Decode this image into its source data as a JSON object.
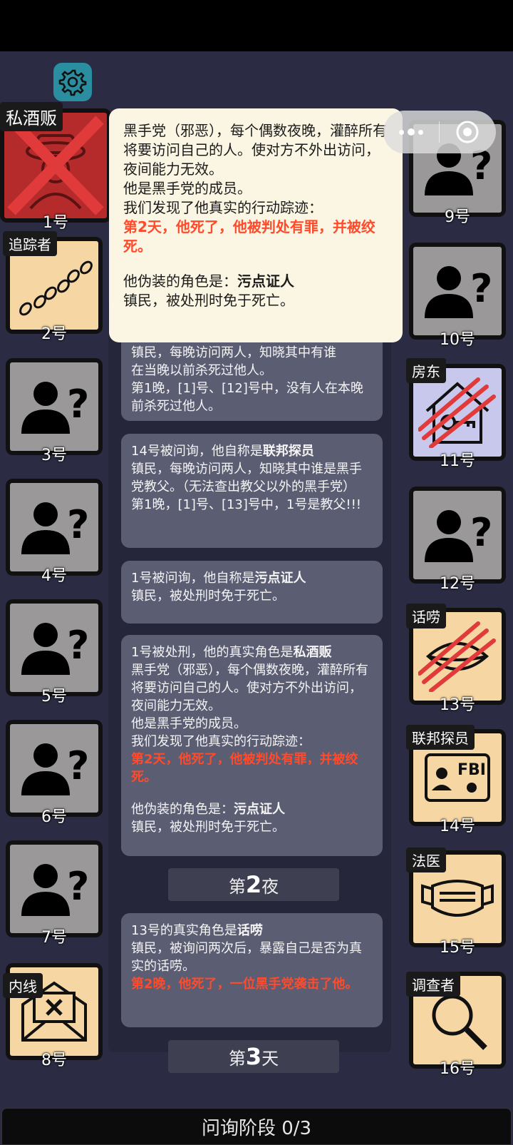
{
  "header": {
    "settings_icon": "gear-icon",
    "menu_icon": "more-dots-icon",
    "close_icon": "target-circle-icon"
  },
  "players": [
    {
      "num": "1号",
      "role": "私酒贩",
      "state": "eliminated"
    },
    {
      "num": "2号",
      "role": "追踪者",
      "state": "known"
    },
    {
      "num": "3号",
      "role": "",
      "state": "unknown"
    },
    {
      "num": "4号",
      "role": "",
      "state": "unknown"
    },
    {
      "num": "5号",
      "role": "",
      "state": "unknown"
    },
    {
      "num": "6号",
      "role": "",
      "state": "unknown"
    },
    {
      "num": "7号",
      "role": "",
      "state": "unknown"
    },
    {
      "num": "8号",
      "role": "内线",
      "state": "known"
    },
    {
      "num": "9号",
      "role": "",
      "state": "unknown"
    },
    {
      "num": "10号",
      "role": "",
      "state": "unknown"
    },
    {
      "num": "11号",
      "role": "房东",
      "state": "dead"
    },
    {
      "num": "12号",
      "role": "",
      "state": "unknown"
    },
    {
      "num": "13号",
      "role": "话唠",
      "state": "dead"
    },
    {
      "num": "14号",
      "role": "联邦探员",
      "state": "known"
    },
    {
      "num": "15号",
      "role": "法医",
      "state": "known"
    },
    {
      "num": "16号",
      "role": "调查者",
      "state": "known"
    }
  ],
  "popup": {
    "line1": "黑手党（邪恶），每个偶数夜晚，灌醉所有将要访问自己的人。使对方不外出访问，夜间能力无效。",
    "line2": "他是黑手党的成员。",
    "line3": "我们发现了他真实的行动踪迹：",
    "red": "第2天，他死了，他被判处有罪，并被绞死。",
    "disguise_prefix": "他伪装的角色是：",
    "disguise_role": "污点证人",
    "disguise_desc": "镇民，被处刑时免于死亡。"
  },
  "log": {
    "msg1": {
      "line1": "镇民，每晚访问两人，知晓其中有谁",
      "line2": "在当晚以前杀死过他人。",
      "line3": "第1晚，[1]号、[12]号中，没有人在本晚前杀死过他人。"
    },
    "msg2": {
      "prefix": "14号被问询，他自称是",
      "role": "联邦探员",
      "desc": "镇民，每晚访问两人，知晓其中谁是黑手党教父。（无法查出教父以外的黑手党）",
      "result": "第1晚，[1]号、[13]号中，1号是教父!!!"
    },
    "msg3": {
      "prefix": "1号被问询，他自称是",
      "role": "污点证人",
      "desc": "镇民，被处刑时免于死亡。"
    },
    "msg4": {
      "prefix": "1号被处刑，他的真实角色是",
      "role": "私酒贩",
      "desc": "黑手党（邪恶），每个偶数夜晚，灌醉所有将要访问自己的人。使对方不外出访问，夜间能力无效。",
      "member": "他是黑手党的成员。",
      "trace": "我们发现了他真实的行动踪迹：",
      "red": "第2天，他死了，他被判处有罪，并被绞死。",
      "disguise_prefix": "他伪装的角色是：",
      "disguise_role": "污点证人",
      "disguise_desc": "镇民，被处刑时免于死亡。"
    },
    "phase1": {
      "pre": "第",
      "num": "2",
      "post": "夜"
    },
    "msg5": {
      "prefix": "13号的真实角色是",
      "role": "话唠",
      "desc": "镇民，被询问两次后，暴露自己是否为真实的话唠。",
      "red": "第2晚，他死了，一位黑手党袭击了他。"
    },
    "phase2": {
      "pre": "第",
      "num": "3",
      "post": "天"
    }
  },
  "footer": {
    "status": "问询阶段 0/3"
  },
  "colors": {
    "accent_red": "#ff4b2b",
    "bg": "#2b2c43",
    "card_tan": "#f6d7a3",
    "unknown_gray": "#9a9898"
  }
}
